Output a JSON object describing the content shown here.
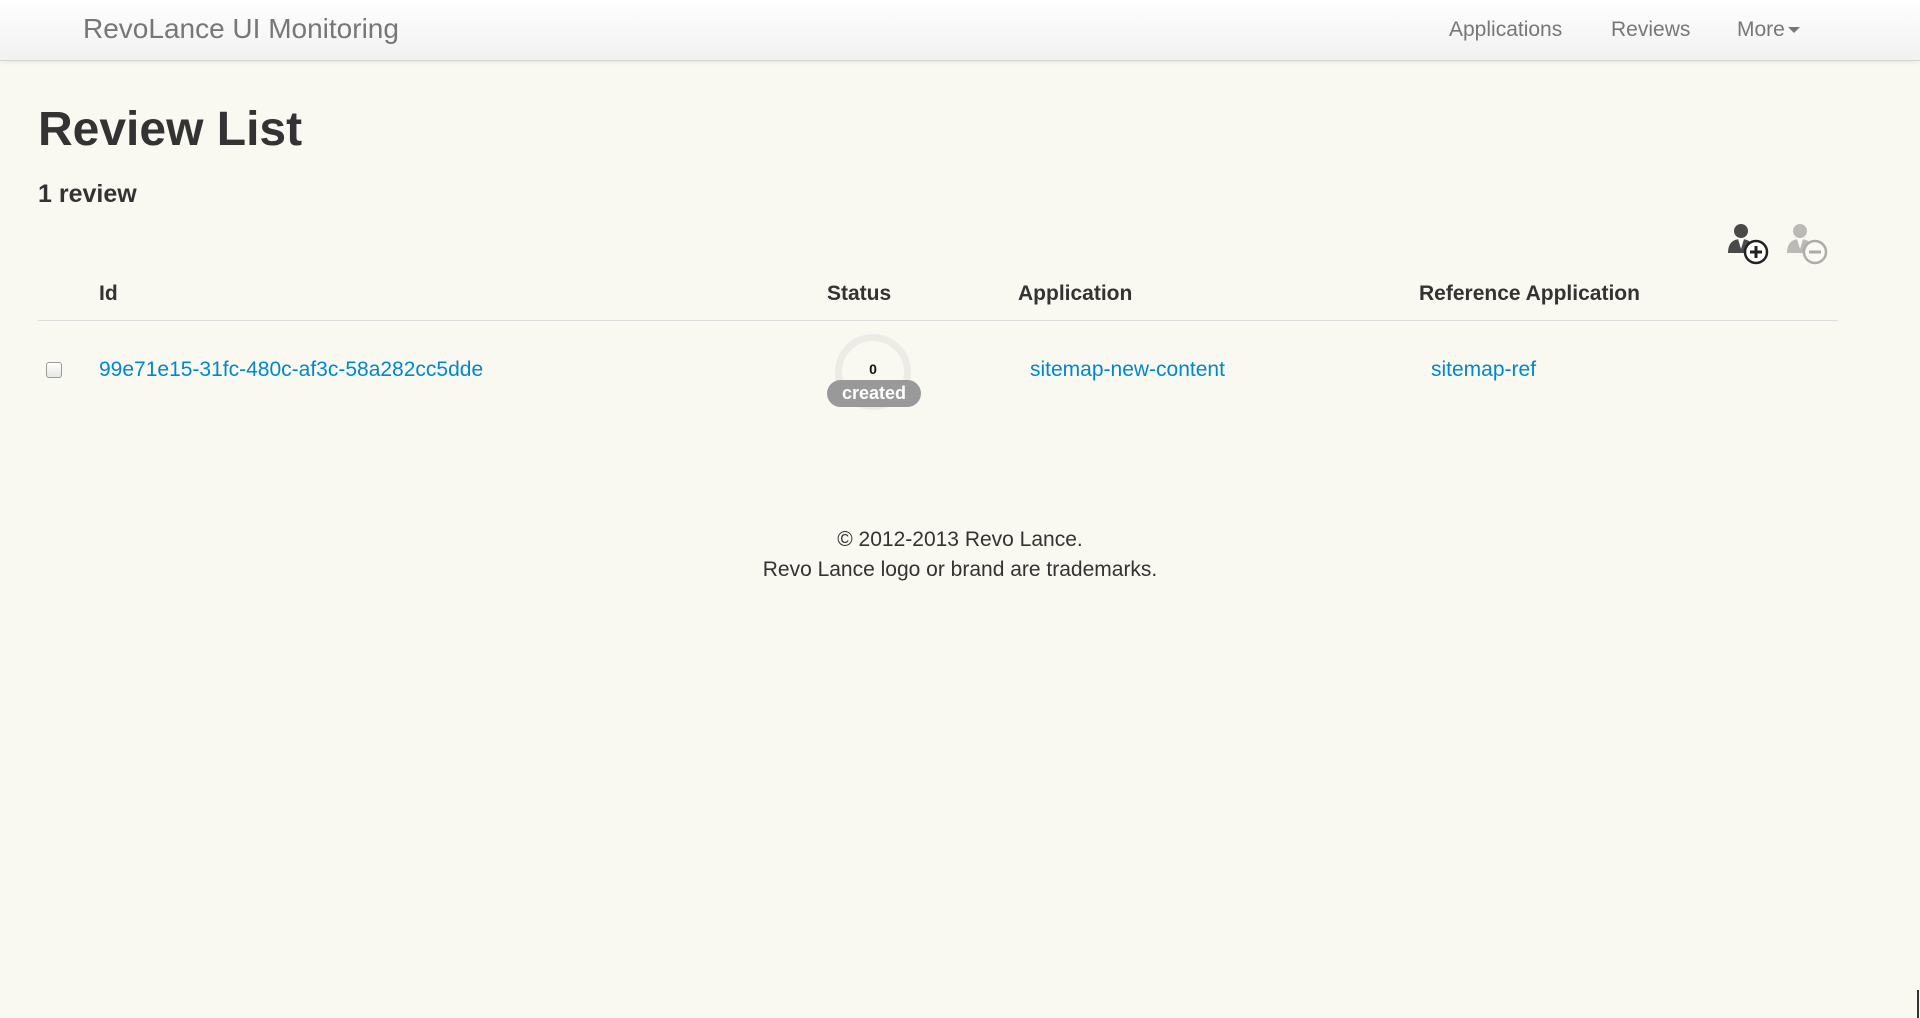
{
  "navbar": {
    "brand": "RevoLance UI Monitoring",
    "links": {
      "applications": "Applications",
      "reviews": "Reviews",
      "more": "More"
    }
  },
  "page": {
    "title": "Review List",
    "count": "1 review"
  },
  "table": {
    "columns": [
      "Id",
      "Status",
      "Application",
      "Reference Application"
    ],
    "rows": [
      {
        "id": "99e71e15-31fc-480c-af3c-58a282cc5dde",
        "status_count": "0",
        "status": "created",
        "application": "sitemap-new-content",
        "reference_application": "sitemap-ref"
      }
    ]
  },
  "footer": {
    "copyright": "© 2012-2013 Revo Lance.",
    "trademark": "Revo Lance logo or brand are trademarks."
  },
  "colors": {
    "link": "#0088cc",
    "background": "#f9f8f1",
    "badge": "#999999"
  },
  "icons": [
    "add-user-icon",
    "remove-user-icon",
    "caret-down-icon"
  ]
}
